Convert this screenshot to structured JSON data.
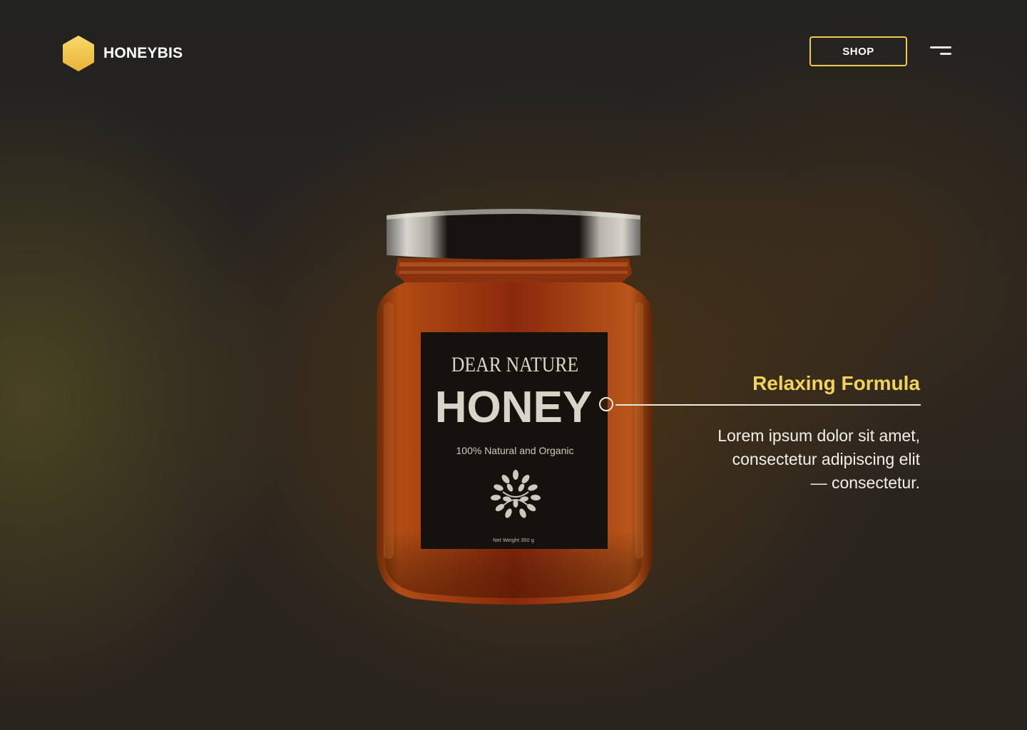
{
  "brand": {
    "name": "HONEYBIS",
    "logo_icon": "hexagon-icon",
    "logo_color": "#f2c94c"
  },
  "header": {
    "shop_label": "SHOP",
    "menu_icon": "menu-icon"
  },
  "product": {
    "label_brand": "DEAR NATURE",
    "label_name": "HONEY",
    "label_tagline": "100% Natural and Organic",
    "label_weight": "Net Weight 350 g",
    "label_icon": "leaf-tree-icon"
  },
  "callout": {
    "title": "Relaxing Formula",
    "text_line1": "Lorem ipsum dolor sit amet,",
    "text_line2": "consectetur adipiscing elit",
    "text_line3": "— consectetur."
  },
  "colors": {
    "accent": "#f2c94c",
    "callout_title": "#f2d35a",
    "text": "#ffffff"
  }
}
